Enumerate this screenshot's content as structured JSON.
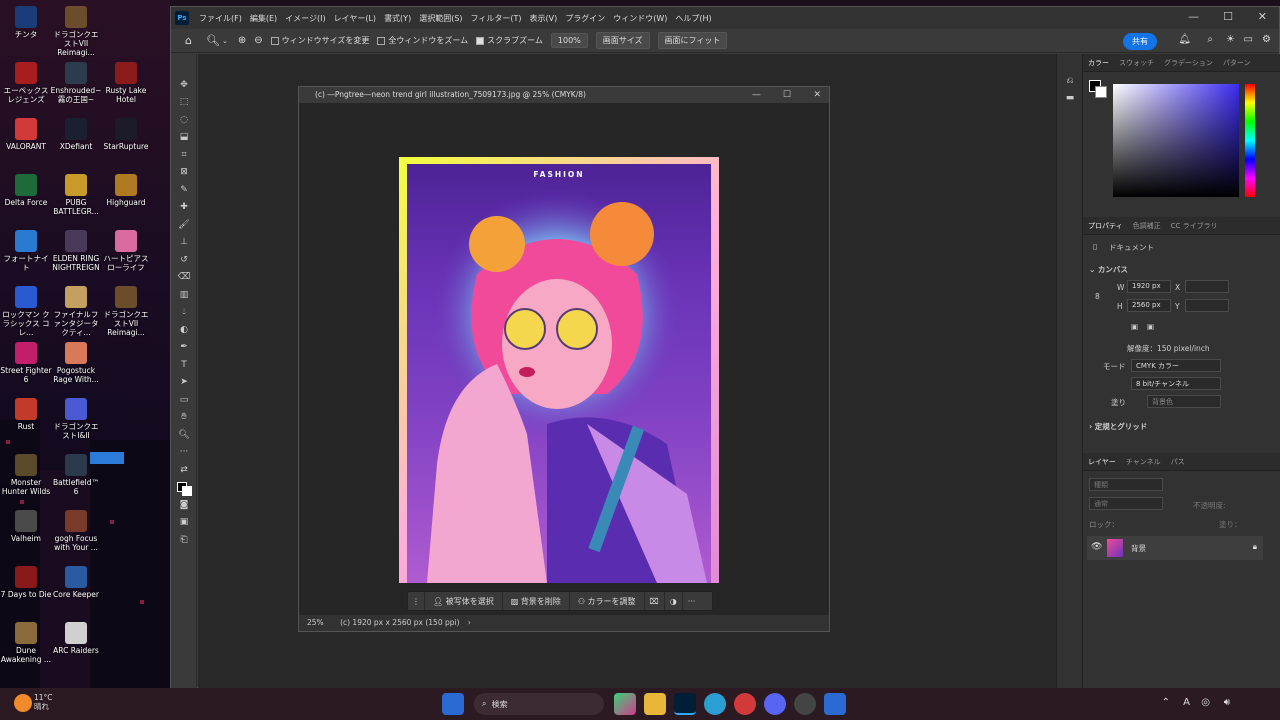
{
  "desktop": {
    "icons": [
      {
        "label": "チンタ",
        "color": "#1a3d7a"
      },
      {
        "label": "ドラゴンクエストVII Reimagi...",
        "color": "#6b4d2b"
      },
      {
        "label": "エーペックスレジェンズ",
        "color": "#a81e1e"
      },
      {
        "label": "Enshrouded~霧の王国~",
        "color": "#2b3d4d"
      },
      {
        "label": "Rusty Lake Hotel",
        "color": "#8b1a1a"
      },
      {
        "label": "VALORANT",
        "color": "#d23a3a"
      },
      {
        "label": "XDefiant",
        "color": "#1b2030"
      },
      {
        "label": "StarRupture",
        "color": "#1b1b2a"
      },
      {
        "label": "Delta Force",
        "color": "#1e6b3a"
      },
      {
        "label": "PUBG BATTLEGR...",
        "color": "#c79a2a"
      },
      {
        "label": "Highguard",
        "color": "#b07a20"
      },
      {
        "label": "フォートナイト",
        "color": "#2a7ad2"
      },
      {
        "label": "ELDEN RING NIGHTREIGN",
        "color": "#4a3a5a"
      },
      {
        "label": "ハートピアスローライフ",
        "color": "#d86aa0"
      },
      {
        "label": "ロックマン クラシックス コレ...",
        "color": "#2a5ad2"
      },
      {
        "label": "ファイナルファンタジータクティ...",
        "color": "#c4a060"
      },
      {
        "label": "ドラゴンクエストVII Reimagi...",
        "color": "#6b4d2b"
      },
      {
        "label": "Street Fighter 6",
        "color": "#c21e6a"
      },
      {
        "label": "Pogostuck Rage With...",
        "color": "#d87a5a"
      },
      {
        "label": "Rust",
        "color": "#c23a2a"
      },
      {
        "label": "ドラゴンクエストI&II",
        "color": "#4a5ad2"
      },
      {
        "label": "Monster Hunter Wilds",
        "color": "#5a4a2a"
      },
      {
        "label": "Battlefield™ 6",
        "color": "#2a3a4a"
      },
      {
        "label": "Valheim",
        "color": "#4a4a4a"
      },
      {
        "label": "gogh Focus with Your ...",
        "color": "#7a3a2a"
      },
      {
        "label": "7 Days to Die",
        "color": "#8a1a1a"
      },
      {
        "label": "Core Keeper",
        "color": "#2a5aa0"
      },
      {
        "label": "Dune Awakening ...",
        "color": "#8a6a3a"
      },
      {
        "label": "ARC Raiders",
        "color": "#d0d0d0"
      }
    ]
  },
  "ps": {
    "menu": [
      "ファイル(F)",
      "編集(E)",
      "イメージ(I)",
      "レイヤー(L)",
      "書式(Y)",
      "選択範囲(S)",
      "フィルター(T)",
      "表示(V)",
      "プラグイン",
      "ウィンドウ(W)",
      "ヘルプ(H)"
    ],
    "options": {
      "resize_label": "ウィンドウサイズを変更",
      "allwin_label": "全ウィンドウをズーム",
      "scrub_label": "スクラブズーム",
      "zoom_value": "100%",
      "screen_size": "画面サイズ",
      "fit_screen": "画面にフィット"
    },
    "share_label": "共有",
    "doc": {
      "title": "(c) ―Pngtree―neon trend girl illustration_7509173.jpg @ 25% (CMYK/8)",
      "art_text": "FASHION",
      "zoom": "25%",
      "status": "(c) 1920 px x 2560 px (150 ppi)"
    },
    "context_bar": {
      "select_subject": "被写体を選択",
      "remove_bg": "背景を削除",
      "adjust_color": "カラーを調整"
    },
    "panels": {
      "color_tabs": [
        "カラー",
        "スウォッチ",
        "グラデーション",
        "パターン"
      ],
      "prop_tabs": [
        "プロパティ",
        "色調補正",
        "CC ライブラリ"
      ],
      "doc_label": "ドキュメント",
      "canvas_label": "カンバス",
      "w_label": "W",
      "w_value": "1920 px",
      "x_label": "X",
      "h_label": "H",
      "h_value": "2560 px",
      "y_label": "Y",
      "resolution": "解像度：150 pixel/inch",
      "mode_label": "モード",
      "mode_value": "CMYK カラー",
      "depth_value": "8 bit/チャンネル",
      "fill_label": "塗り",
      "fill_value": "背景色",
      "rulers_label": "定規とグリッド",
      "layer_tabs": [
        "レイヤー",
        "チャンネル",
        "パス"
      ],
      "layer_kind": "種類",
      "blend": "通常",
      "opacity": "不透明度:",
      "lock": "ロック：",
      "fill": "塗り：",
      "layer_name": "背景"
    }
  },
  "taskbar": {
    "weather_temp": "11°C",
    "weather_desc": "晴れ",
    "search_placeholder": "検索"
  }
}
